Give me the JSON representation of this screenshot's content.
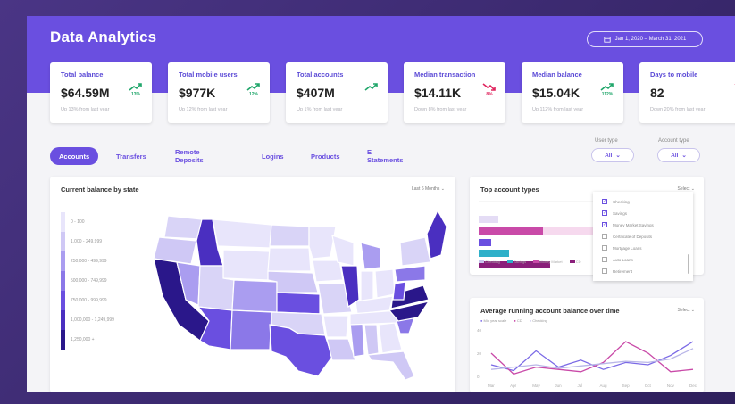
{
  "app": {
    "title": "Data Analytics",
    "date_range": "Jan 1, 2020 – March 31, 2021"
  },
  "kpis": [
    {
      "label": "Total balance",
      "value": "$64.59M",
      "trend": "up",
      "pct": "13%",
      "sub": "Up 13% from last year"
    },
    {
      "label": "Total mobile users",
      "value": "$977K",
      "trend": "up",
      "pct": "12%",
      "sub": "Up 12% from last year"
    },
    {
      "label": "Total accounts",
      "value": "$407M",
      "trend": "up",
      "pct": "",
      "sub": "Up 1% from last year"
    },
    {
      "label": "Median transaction",
      "value": "$14.11K",
      "trend": "down",
      "pct": "8%",
      "sub": "Down 8% from last year"
    },
    {
      "label": "Median balance",
      "value": "$15.04K",
      "trend": "up",
      "pct": "112%",
      "sub": "Up 112% from last year"
    },
    {
      "label": "Days to mobile",
      "value": "82",
      "trend": "down",
      "pct": "",
      "sub": "Down 20% from last year"
    }
  ],
  "tabs": [
    "Accounts",
    "Transfers",
    "Remote Deposits",
    "Logins",
    "Products",
    "E Statements"
  ],
  "filters": {
    "user_type": {
      "label": "User type",
      "value": "All"
    },
    "account_type": {
      "label": "Account type",
      "value": "All"
    }
  },
  "map_card": {
    "title": "Current balance by state",
    "period": "Last 6 Months",
    "legend": [
      "0 - 100",
      "1,000 - 249,999",
      "250,000 - 499,999",
      "500,000 - 749,999",
      "750,000 - 999,999",
      "1,000,000 - 1,249,999",
      "1,250,000 +"
    ]
  },
  "top_accounts": {
    "title": "Top account types",
    "select": "Select",
    "options": [
      {
        "label": "Checking",
        "checked": true
      },
      {
        "label": "Savings",
        "checked": true
      },
      {
        "label": "Money Market Savings",
        "checked": true
      },
      {
        "label": "Certificate of Deposits",
        "checked": false
      },
      {
        "label": "Mortgage Loans",
        "checked": false
      },
      {
        "label": "Auto Loans",
        "checked": false
      },
      {
        "label": "Retirement",
        "checked": false
      }
    ],
    "legend": [
      "Checking",
      "Savings",
      "Money Market",
      "CD"
    ]
  },
  "running_balance": {
    "title": "Average running account balance over time",
    "select": "Select",
    "legend": [
      "Mid year scale",
      "CD",
      "Checking"
    ],
    "y_ticks": [
      "40",
      "20",
      "0"
    ],
    "x_ticks": [
      "Mar",
      "Apr",
      "May",
      "Jun",
      "Jul",
      "Aug",
      "Sep",
      "Oct",
      "Nov",
      "Dec"
    ]
  },
  "chart_data": {
    "type": "line",
    "x": [
      "Mar",
      "Apr",
      "May",
      "Jun",
      "Jul",
      "Aug",
      "Sep",
      "Oct",
      "Nov",
      "Dec"
    ],
    "series": [
      {
        "name": "Mid year scale",
        "values": [
          10,
          5,
          22,
          8,
          14,
          6,
          12,
          10,
          18,
          30
        ]
      },
      {
        "name": "CD",
        "values": [
          20,
          2,
          8,
          6,
          4,
          12,
          30,
          20,
          4,
          6
        ]
      },
      {
        "name": "Checking",
        "values": [
          6,
          8,
          10,
          7,
          9,
          11,
          13,
          12,
          15,
          24
        ]
      }
    ],
    "colors": [
      "#7b6ae6",
      "#c94aa8",
      "#b9b6e8"
    ],
    "ylim": [
      0,
      40
    ]
  },
  "colors": {
    "brand": "#6a4fe0",
    "up": "#1fa66a",
    "down": "#e0245e"
  }
}
